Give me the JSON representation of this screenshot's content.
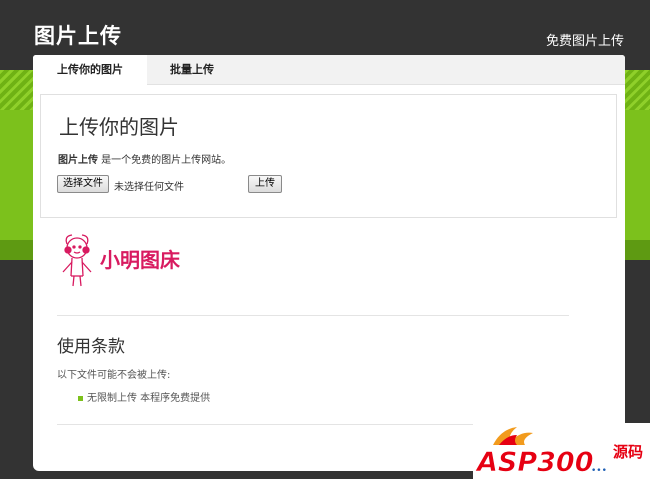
{
  "header": {
    "site_title": "图片上传",
    "top_link": "免费图片上传"
  },
  "tabs": [
    {
      "label": "上传你的图片",
      "active": true
    },
    {
      "label": "批量上传",
      "active": false
    }
  ],
  "upload": {
    "heading": "上传你的图片",
    "intro_bold": "图片上传",
    "intro_rest": " 是一个免费的图片上传网站。",
    "choose_button": "选择文件",
    "file_status": "未选择任何文件",
    "upload_button": "上传"
  },
  "logo": {
    "text": "小明图床",
    "color": "#d81b60"
  },
  "terms": {
    "heading": "使用条款",
    "intro": "以下文件可能不会被上传:",
    "items": [
      "无限制上传 本程序免费提供"
    ]
  },
  "watermark": {
    "text": "ASP300",
    "suffix": "源码"
  },
  "colors": {
    "background": "#333333",
    "accent_green": "#7cc11c",
    "logo_pink": "#d81b60",
    "watermark_red": "#e60012",
    "watermark_blue": "#1e5fb4"
  }
}
